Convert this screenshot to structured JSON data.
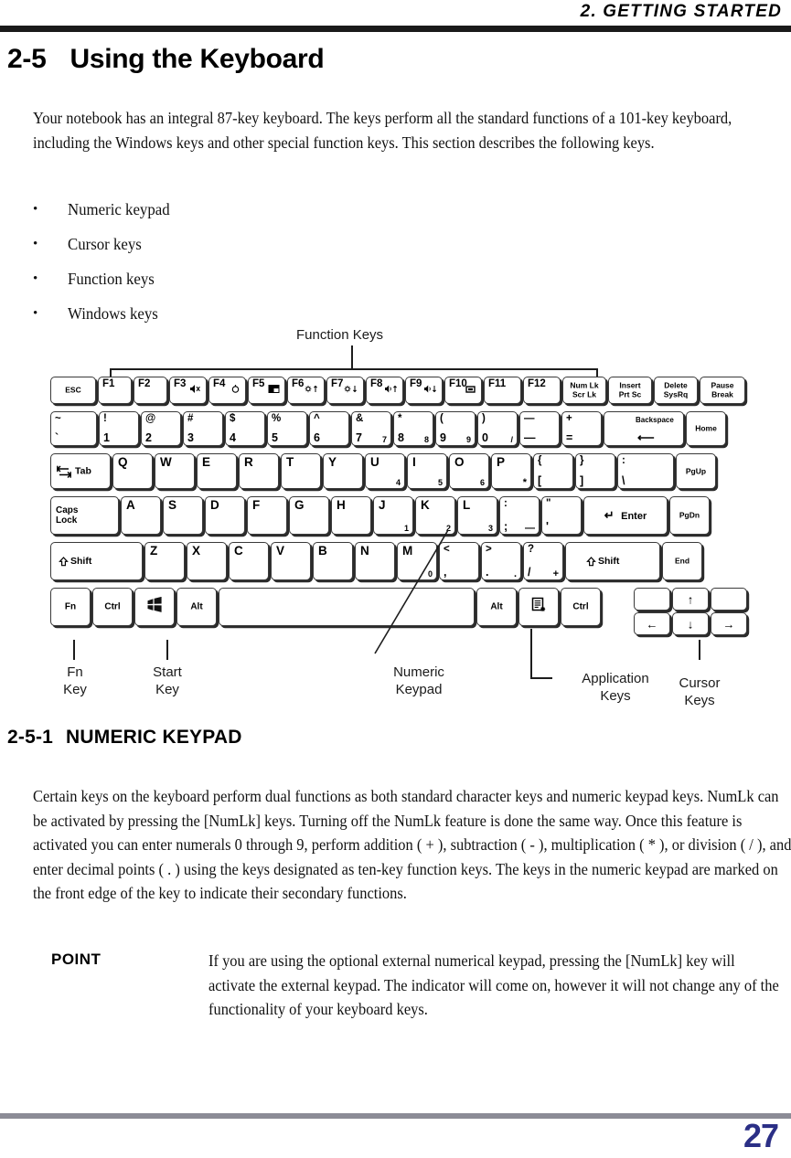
{
  "header": {
    "title": "2.  GETTING STARTED"
  },
  "section": {
    "number": "2-5",
    "title": "Using the Keyboard",
    "intro": "Your notebook has an integral 87-key keyboard. The keys perform all the standard functions of a 101-key keyboard, including the Windows keys and other special function keys. This section describes the following keys.",
    "bullets": [
      {
        "dot": "•",
        "label": "Numeric keypad"
      },
      {
        "dot": "•",
        "label": "Cursor keys"
      },
      {
        "dot": "•",
        "label": "Function keys"
      },
      {
        "dot": "•",
        "label": "Windows keys"
      }
    ]
  },
  "subsection": {
    "number": "2-5-1",
    "title": "NUMERIC  KEYPAD",
    "body": "Certain keys on the keyboard perform dual functions as both standard character keys and numeric keypad keys. NumLk can be activated by pressing the [NumLk] keys. Turning off the NumLk feature is done the same way. Once this feature is activated you can enter numerals 0 through 9, perform addition ( + ), subtraction ( - ), multiplication ( * ), or division ( / ), and enter decimal points ( . ) using the keys designated as ten-key function keys. The keys in the numeric keypad are marked on the front edge of the key to indicate their secondary functions."
  },
  "point": {
    "label": "POINT",
    "body": " If you are using the optional external numerical keypad, pressing the [NumLk] key will activate the external keypad. The indicator will come on, however it will not change any of the functionality of your keyboard keys."
  },
  "footer": {
    "page_number": "27",
    "rule_color": "#8c8c96",
    "page_number_color": "#2b2f86"
  },
  "diagram": {
    "callouts": {
      "function_keys": "Function Keys",
      "fn_key": "Fn\nKey",
      "fn_key_l1": "Fn",
      "fn_key_l2": "Key",
      "start_key_l1": "Start",
      "start_key_l2": "Key",
      "numeric_keypad_l1": "Numeric",
      "numeric_keypad_l2": "Keypad",
      "application_keys_l1": "Application",
      "application_keys_l2": "Keys",
      "cursor_keys_l1": "Cursor",
      "cursor_keys_l2": "Keys"
    },
    "rows": {
      "function_row": [
        {
          "name": "esc",
          "ctr": "ESC"
        },
        {
          "name": "f1",
          "tl": "F1"
        },
        {
          "name": "f2",
          "tl": "F2"
        },
        {
          "name": "f3",
          "tl": "F3",
          "glyph": "mute-icon"
        },
        {
          "name": "f4",
          "tl": "F4",
          "glyph": "speaker-icon"
        },
        {
          "name": "f5",
          "tl": "F5",
          "glyph": "display-icon"
        },
        {
          "name": "f6",
          "tl": "F6",
          "glyph": "brightness-down-icon"
        },
        {
          "name": "f7",
          "tl": "F7",
          "glyph": "brightness-up-icon"
        },
        {
          "name": "f8",
          "tl": "F8",
          "glyph": "volume-down-icon"
        },
        {
          "name": "f9",
          "tl": "F9",
          "glyph": "volume-up-icon"
        },
        {
          "name": "f10",
          "tl": "F10",
          "glyph": "monitor-icon"
        },
        {
          "name": "f11",
          "tl": "F11"
        },
        {
          "name": "f12",
          "tl": "F12"
        },
        {
          "name": "numlk",
          "l1": "Num Lk",
          "l2": "Scr Lk"
        },
        {
          "name": "insert",
          "l1": "Insert",
          "l2": "Prt Sc"
        },
        {
          "name": "delete",
          "l1": "Delete",
          "l2": "SysRq"
        },
        {
          "name": "pause",
          "l1": "Pause",
          "l2": "Break"
        }
      ],
      "number_row": [
        {
          "name": "tilde",
          "top": "~",
          "bottom": "`"
        },
        {
          "name": "one",
          "top": "!",
          "bottom": "1"
        },
        {
          "name": "two",
          "top": "@",
          "bottom": "2"
        },
        {
          "name": "three",
          "top": "#",
          "bottom": "3"
        },
        {
          "name": "four",
          "top": "$",
          "bottom": "4"
        },
        {
          "name": "five",
          "top": "%",
          "bottom": "5"
        },
        {
          "name": "six",
          "top": "^",
          "bottom": "6"
        },
        {
          "name": "seven",
          "top": "&",
          "bottom": "7",
          "pad": "7"
        },
        {
          "name": "eight",
          "top": "*",
          "bottom": "8",
          "pad": "8"
        },
        {
          "name": "nine",
          "top": "(",
          "bottom": "9",
          "pad": "9"
        },
        {
          "name": "zero",
          "top": ")",
          "bottom": "0",
          "pad": "/"
        },
        {
          "name": "minus",
          "top": "—",
          "bottom": "—"
        },
        {
          "name": "equal",
          "top": "+",
          "bottom": "="
        },
        {
          "name": "backspace",
          "ctr": "Backspace",
          "arrow": "⟵"
        },
        {
          "name": "home",
          "ctr": "Home"
        }
      ],
      "qwerty_row": [
        {
          "name": "tab",
          "ctr": "Tab"
        },
        {
          "name": "q",
          "letter": "Q"
        },
        {
          "name": "w",
          "letter": "W"
        },
        {
          "name": "e",
          "letter": "E"
        },
        {
          "name": "r",
          "letter": "R"
        },
        {
          "name": "t",
          "letter": "T"
        },
        {
          "name": "y",
          "letter": "Y"
        },
        {
          "name": "u",
          "letter": "U",
          "pad": "4"
        },
        {
          "name": "i",
          "letter": "I",
          "pad": "5"
        },
        {
          "name": "o",
          "letter": "O",
          "pad": "6"
        },
        {
          "name": "p",
          "letter": "P",
          "pad": "*"
        },
        {
          "name": "bracket-left",
          "top": "{",
          "bottom": "["
        },
        {
          "name": "bracket-right",
          "top": "}",
          "bottom": "]"
        },
        {
          "name": "backslash",
          "top": ":",
          "bottom": "\\"
        },
        {
          "name": "pgup",
          "ctr": "PgUp"
        }
      ],
      "home_row": [
        {
          "name": "capslock",
          "l1": "Caps",
          "l2": "Lock"
        },
        {
          "name": "a",
          "letter": "A"
        },
        {
          "name": "s",
          "letter": "S"
        },
        {
          "name": "d",
          "letter": "D"
        },
        {
          "name": "f",
          "letter": "F"
        },
        {
          "name": "g",
          "letter": "G"
        },
        {
          "name": "h",
          "letter": "H"
        },
        {
          "name": "j",
          "letter": "J",
          "pad": "1"
        },
        {
          "name": "k",
          "letter": "K",
          "pad": "2"
        },
        {
          "name": "l",
          "letter": "L",
          "pad": "3"
        },
        {
          "name": "semicolon",
          "top": ":",
          "bottom": ";",
          "pad": "—"
        },
        {
          "name": "quote",
          "top": "\"",
          "bottom": "'"
        },
        {
          "name": "enter",
          "ctr": "Enter",
          "arrow": "↵"
        },
        {
          "name": "pgdn",
          "ctr": "PgDn"
        }
      ],
      "shift_row": [
        {
          "name": "shift-left",
          "ctr": "Shift",
          "glyph": "shift-arrow-icon"
        },
        {
          "name": "z",
          "letter": "Z"
        },
        {
          "name": "x",
          "letter": "X"
        },
        {
          "name": "c",
          "letter": "C"
        },
        {
          "name": "v",
          "letter": "V"
        },
        {
          "name": "b",
          "letter": "B"
        },
        {
          "name": "n",
          "letter": "N"
        },
        {
          "name": "m",
          "letter": "M",
          "pad": "0"
        },
        {
          "name": "comma",
          "top": "<",
          "bottom": ","
        },
        {
          "name": "period",
          "top": ">",
          "bottom": ".",
          "pad": "."
        },
        {
          "name": "slash",
          "top": "?",
          "bottom": "/",
          "pad": "+"
        },
        {
          "name": "shift-right",
          "ctr": "Shift",
          "glyph": "shift-arrow-icon"
        },
        {
          "name": "end",
          "ctr": "End"
        }
      ],
      "bottom_row": [
        {
          "name": "fn",
          "ctr": "Fn"
        },
        {
          "name": "ctrl-left",
          "ctr": "Ctrl"
        },
        {
          "name": "start",
          "glyph": "windows-logo-icon"
        },
        {
          "name": "alt-left",
          "ctr": "Alt"
        },
        {
          "name": "space",
          "ctr": ""
        },
        {
          "name": "alt-right",
          "ctr": "Alt"
        },
        {
          "name": "application",
          "glyph": "application-menu-icon"
        },
        {
          "name": "ctrl-right",
          "ctr": "Ctrl"
        }
      ],
      "cursor_cluster": [
        {
          "name": "blank-left",
          "ctr": ""
        },
        {
          "name": "arrow-up",
          "arrow": "↑"
        },
        {
          "name": "blank-right",
          "ctr": ""
        },
        {
          "name": "arrow-left",
          "arrow": "←"
        },
        {
          "name": "arrow-down",
          "arrow": "↓"
        },
        {
          "name": "arrow-right",
          "arrow": "→"
        }
      ]
    }
  }
}
